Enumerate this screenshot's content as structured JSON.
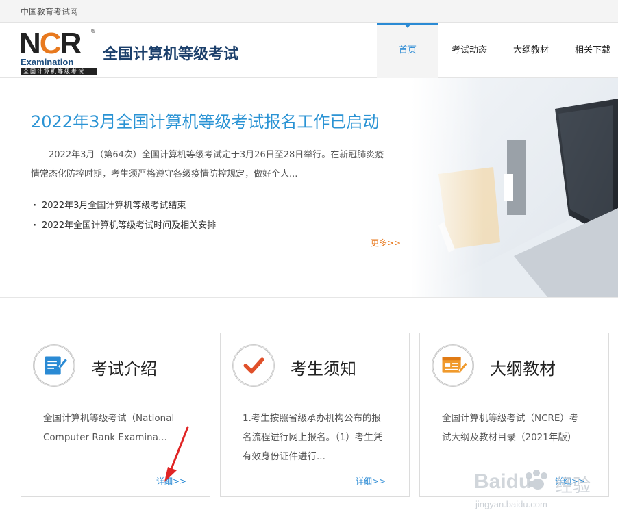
{
  "topbar": {
    "site_name": "中国教育考试网"
  },
  "header": {
    "logo": {
      "letters": [
        "N",
        "C",
        "R"
      ],
      "reg_mark": "®",
      "sub_en": "Examination",
      "sub_cn": "全国计算机等级考试"
    },
    "title": "全国计算机等级考试"
  },
  "nav": {
    "items": [
      {
        "label": "首页",
        "active": true
      },
      {
        "label": "考试动态",
        "active": false
      },
      {
        "label": "大纲教材",
        "active": false
      },
      {
        "label": "相关下载",
        "active": false
      }
    ]
  },
  "banner": {
    "title": "2022年3月全国计算机等级考试报名工作已启动",
    "description": "2022年3月（第64次）全国计算机等级考试定于3月26日至28日举行。在新冠肺炎疫情常态化防控时期，考生须严格遵守各级疫情防控规定，做好个人...",
    "links": [
      "2022年3月全国计算机等级考试结束",
      "2022年全国计算机等级考试时间及相关安排"
    ],
    "more_label": "更多>>"
  },
  "cards": [
    {
      "title": "考试介绍",
      "icon": "document-icon",
      "text": "全国计算机等级考试（National Computer Rank Examina...",
      "more_label": "详细>>"
    },
    {
      "title": "考生须知",
      "icon": "checkmark-icon",
      "text": "1.考生按照省级承办机构公布的报名流程进行网上报名。（1）考生凭有效身份证件进行...",
      "more_label": "详细>>"
    },
    {
      "title": "大纲教材",
      "icon": "syllabus-icon",
      "text": "全国计算机等级考试（NCRE）考试大纲及教材目录（2021年版）",
      "more_label": "详细>>"
    }
  ],
  "watermark": {
    "brand": "Baidu",
    "brand_cn": "经验",
    "url": "jingyan.baidu.com"
  },
  "colors": {
    "accent_blue": "#2a8ad4",
    "accent_orange": "#e8791e",
    "title_navy": "#1b3f6b"
  }
}
